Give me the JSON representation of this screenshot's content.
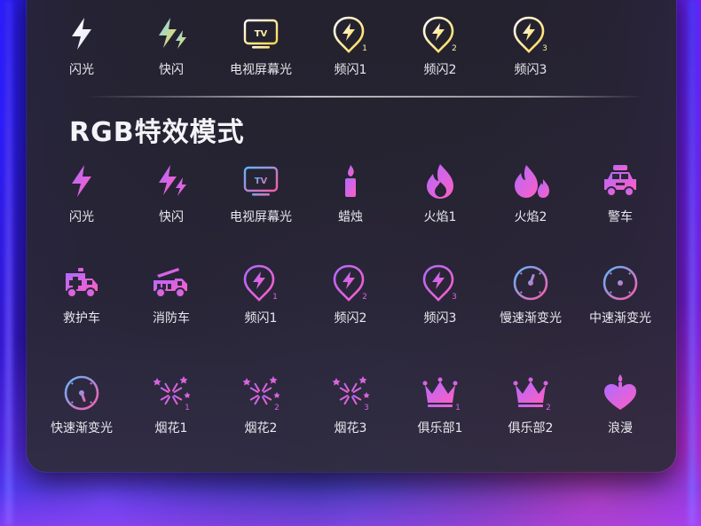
{
  "colors": {
    "white_icon_gradient": [
      "#ffffff",
      "#dfe4ff"
    ],
    "neon_gradient": [
      "#5ab8ff",
      "#ff5aa8"
    ],
    "purple_gradient": [
      "#b06aff",
      "#ff5ec4"
    ]
  },
  "section_title": "RGB特效模式",
  "white_modes": [
    {
      "label": "闪光",
      "icon": "lightning-icon"
    },
    {
      "label": "快闪",
      "icon": "double-lightning-icon"
    },
    {
      "label": "电视屏幕光",
      "icon": "tv-icon",
      "text": "TV"
    },
    {
      "label": "频闪1",
      "icon": "strobe-icon",
      "num": "1"
    },
    {
      "label": "频闪2",
      "icon": "strobe-icon",
      "num": "2"
    },
    {
      "label": "频闪3",
      "icon": "strobe-icon",
      "num": "3"
    }
  ],
  "rgb_rows": [
    [
      {
        "label": "闪光",
        "icon": "lightning-icon"
      },
      {
        "label": "快闪",
        "icon": "double-lightning-icon"
      },
      {
        "label": "电视屏幕光",
        "icon": "tv-icon",
        "text": "TV"
      },
      {
        "label": "蜡烛",
        "icon": "candle-icon"
      },
      {
        "label": "火焰1",
        "icon": "flame-icon"
      },
      {
        "label": "火焰2",
        "icon": "double-flame-icon"
      },
      {
        "label": "警车",
        "icon": "police-car-icon"
      }
    ],
    [
      {
        "label": "救护车",
        "icon": "ambulance-icon"
      },
      {
        "label": "消防车",
        "icon": "fire-truck-icon"
      },
      {
        "label": "频闪1",
        "icon": "strobe-icon",
        "num": "1"
      },
      {
        "label": "频闪2",
        "icon": "strobe-icon",
        "num": "2"
      },
      {
        "label": "频闪3",
        "icon": "strobe-icon",
        "num": "3"
      },
      {
        "label": "慢速渐变光",
        "icon": "gauge-slow-icon"
      },
      {
        "label": "中速渐变光",
        "icon": "gauge-medium-icon"
      }
    ],
    [
      {
        "label": "快速渐变光",
        "icon": "gauge-fast-icon"
      },
      {
        "label": "烟花1",
        "icon": "firework-icon",
        "num": "1"
      },
      {
        "label": "烟花2",
        "icon": "firework-icon",
        "num": "2"
      },
      {
        "label": "烟花3",
        "icon": "firework-icon",
        "num": "3"
      },
      {
        "label": "俱乐部1",
        "icon": "crown-icon",
        "num": "1"
      },
      {
        "label": "俱乐部2",
        "icon": "crown-icon",
        "num": "2"
      },
      {
        "label": "浪漫",
        "icon": "heart-candle-icon"
      }
    ]
  ]
}
